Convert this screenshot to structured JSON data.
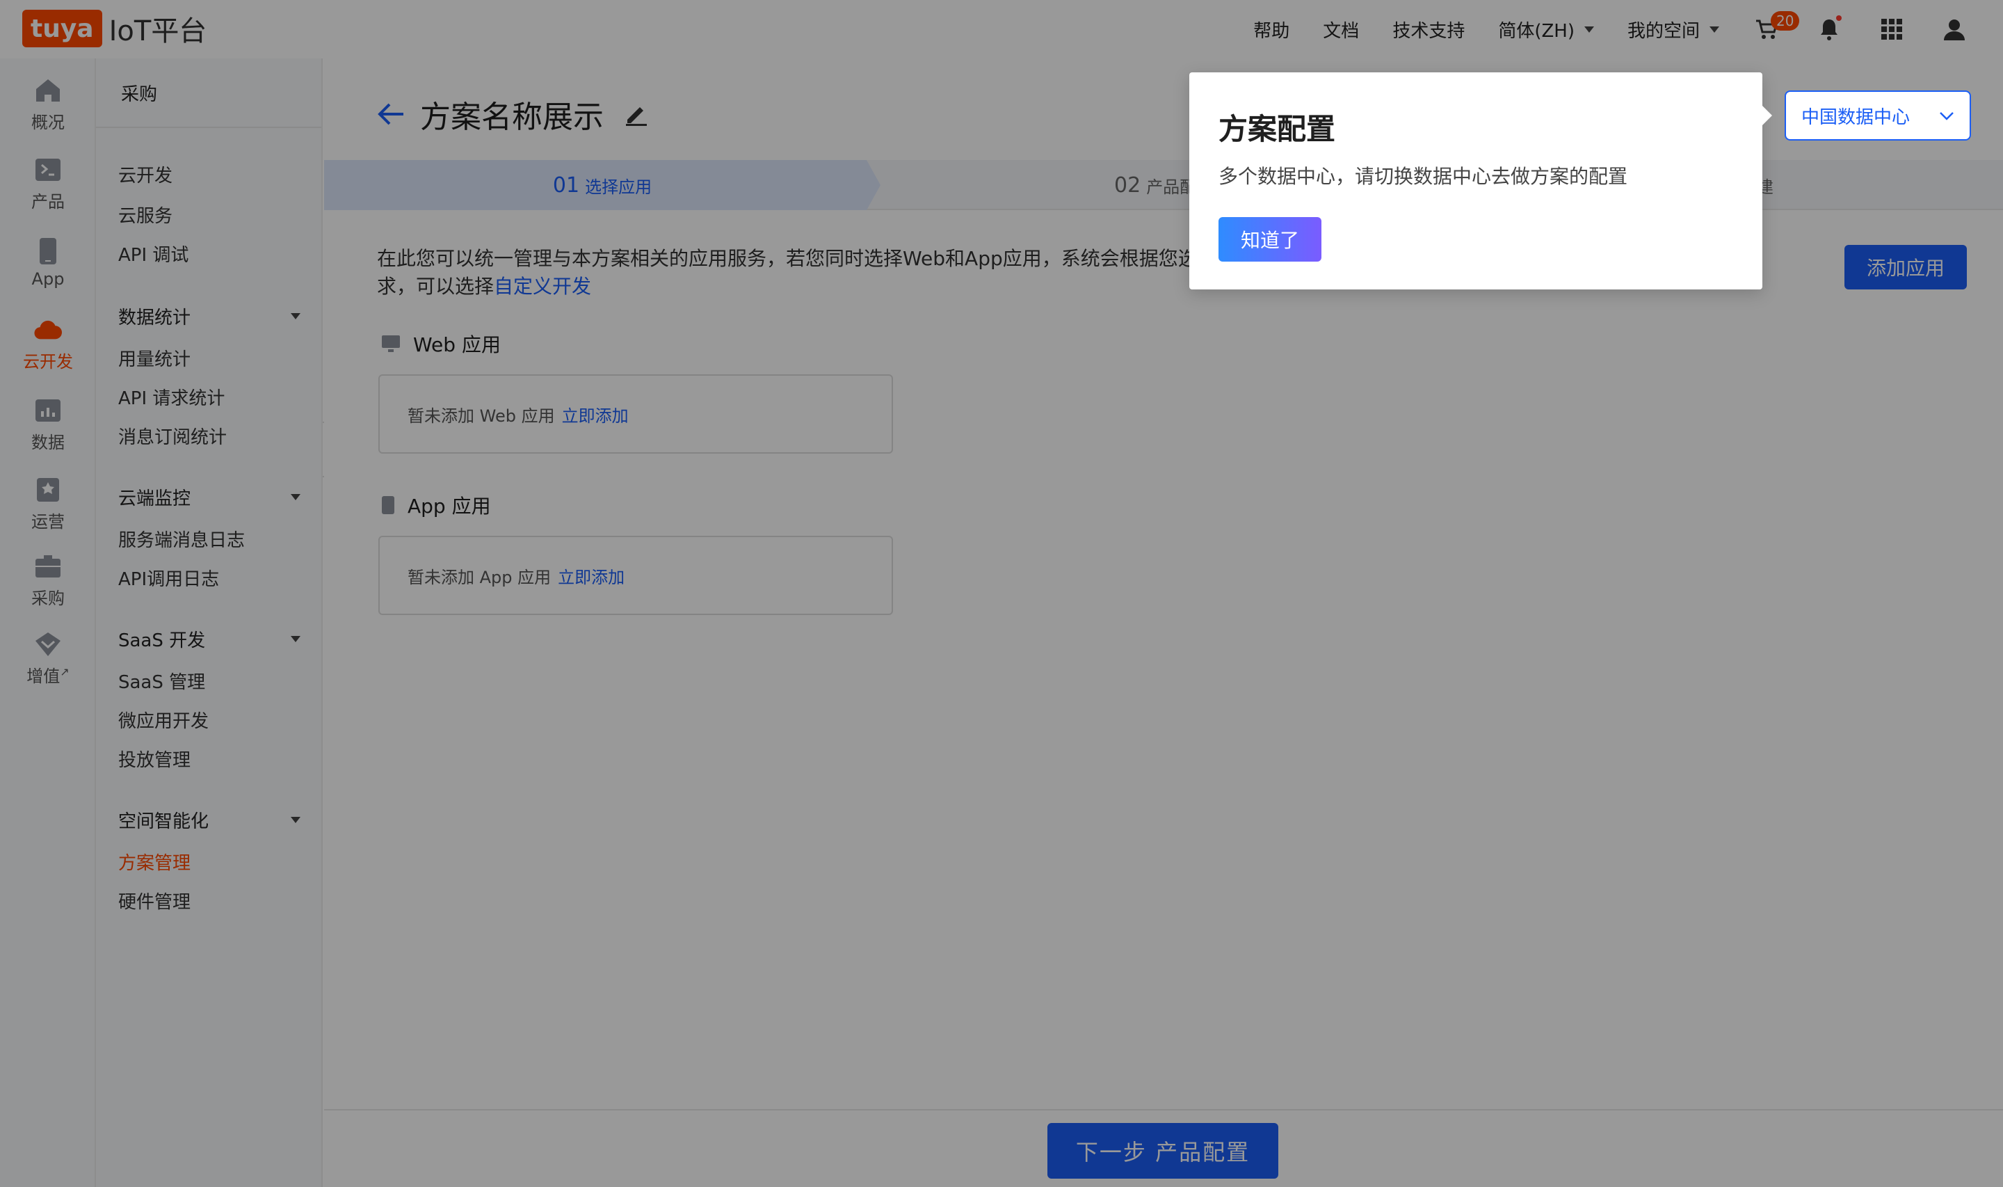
{
  "topbar": {
    "logo_mark": "tuya",
    "logo_text": "IoT平台",
    "nav": {
      "help": "帮助",
      "docs": "文档",
      "support": "技术支持",
      "language": "简体(ZH)",
      "my_space": "我的空间"
    },
    "cart_count": "20",
    "icons": [
      "cart-icon",
      "bell-icon",
      "apps-grid-icon",
      "user-icon"
    ]
  },
  "rail": [
    {
      "label": "概况",
      "icon": "home-icon"
    },
    {
      "label": "产品",
      "icon": "product-icon"
    },
    {
      "label": "App",
      "icon": "phone-icon"
    },
    {
      "label": "云开发",
      "icon": "cloud-icon",
      "active": true
    },
    {
      "label": "数据",
      "icon": "chart-icon"
    },
    {
      "label": "运营",
      "icon": "operation-icon"
    },
    {
      "label": "采购",
      "icon": "purchase-icon"
    },
    {
      "label": "增值",
      "icon": "value-added-icon"
    }
  ],
  "menu": {
    "header": "采购",
    "items": [
      "云开发",
      "云服务",
      "API 调试"
    ],
    "groups": [
      {
        "title": "数据统计",
        "items": [
          "用量统计",
          "API 请求统计",
          "消息订阅统计"
        ]
      },
      {
        "title": "云端监控",
        "items": [
          "服务端消息日志",
          "API调用日志"
        ]
      },
      {
        "title": "SaaS 开发",
        "items": [
          "SaaS 管理",
          "微应用开发",
          "投放管理"
        ]
      },
      {
        "title": "空间智能化",
        "items": [
          "方案管理",
          "硬件管理"
        ]
      }
    ],
    "active": "方案管理"
  },
  "page": {
    "title": "方案名称展示",
    "data_center": "中国数据中心",
    "steps": [
      {
        "num": "01",
        "label": "选择应用"
      },
      {
        "num": "02",
        "label": "产品配置"
      },
      {
        "num": "",
        "label": "建"
      }
    ],
    "description_part1": "在此您可以统一管理与本方案相关的应用服务，若您同时选择Web和App应用，系统会根据您选",
    "description_part2": "求，可以选择",
    "description_link": "自定义开发",
    "add_app_button": "添加应用",
    "web_section": {
      "title": "Web 应用",
      "empty_text": "暂未添加 Web 应用",
      "add_link": "立即添加"
    },
    "app_section": {
      "title": "App 应用",
      "empty_text": "暂未添加 App 应用",
      "add_link": "立即添加"
    },
    "next_button": "下一步 产品配置"
  },
  "popover": {
    "title": "方案配置",
    "body": "多个数据中心，请切换数据中心去做方案的配置",
    "button": "知道了"
  },
  "colors": {
    "brand": "#ff4800",
    "primary": "#1b5ef5",
    "mask": "rgba(0,0,0,0.4)"
  }
}
